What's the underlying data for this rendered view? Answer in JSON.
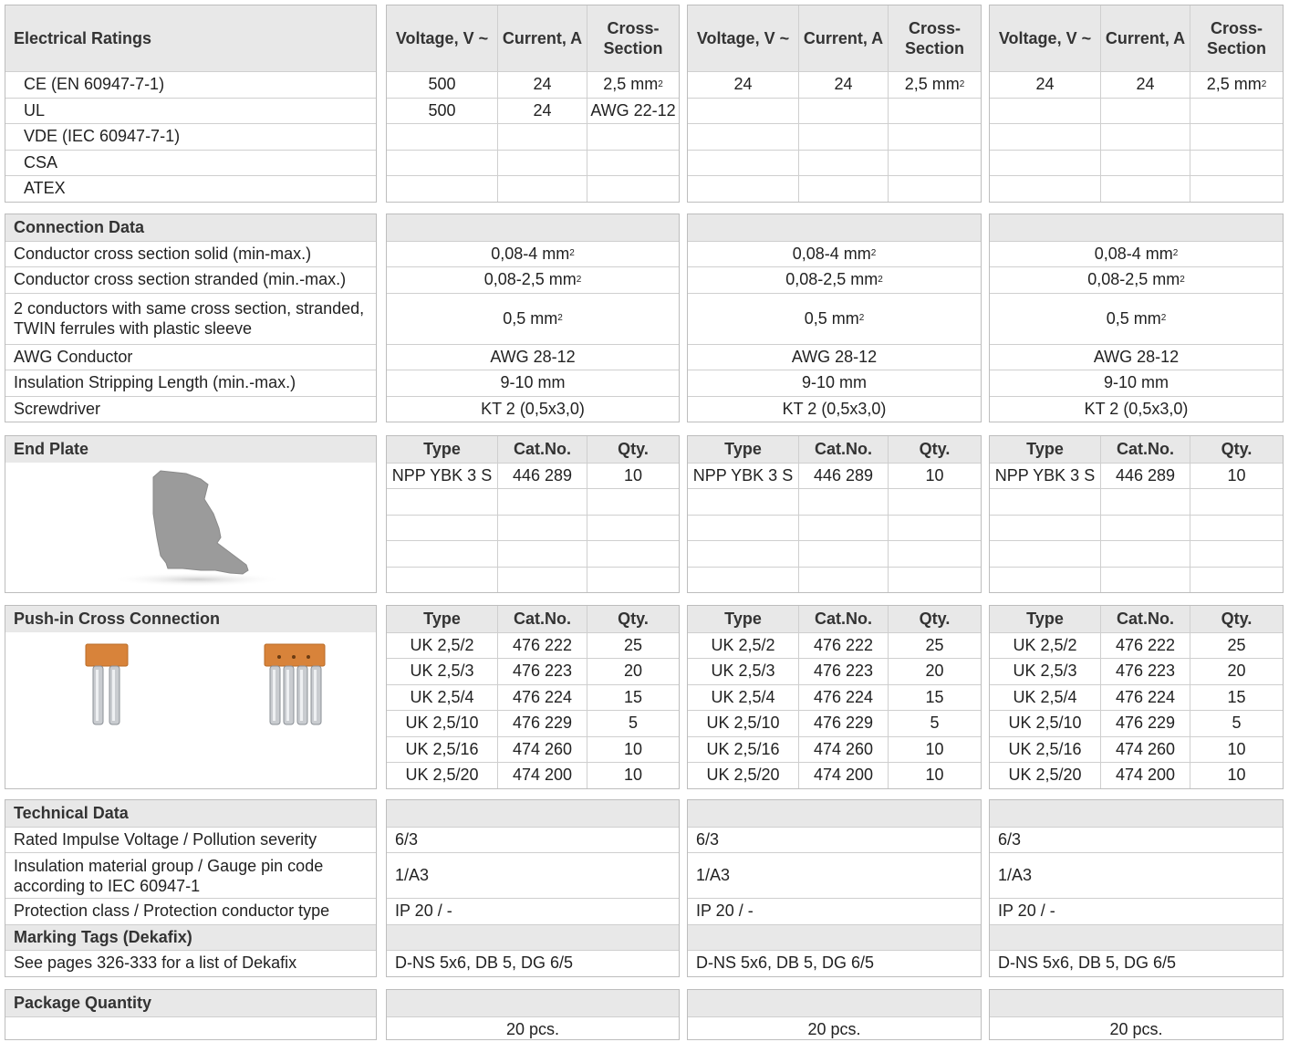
{
  "units": {
    "mm2": "mm",
    "sq": "2"
  },
  "electrical": {
    "title": "Electrical Ratings",
    "headers": [
      "Voltage, V ~",
      "Current, A",
      "Cross-Section"
    ],
    "rows": [
      "CE (EN 60947-7-1)",
      "UL",
      "VDE (IEC 60947-7-1)",
      "CSA",
      "ATEX"
    ],
    "columns": [
      {
        "ce": {
          "v": "500",
          "a": "24",
          "cs": "2,5 mm"
        },
        "ul": {
          "v": "500",
          "a": "24",
          "cs": "AWG 22-12"
        }
      },
      {
        "ce": {
          "v": "24",
          "a": "24",
          "cs": "2,5 mm"
        },
        "ul": {
          "v": "",
          "a": "",
          "cs": ""
        }
      },
      {
        "ce": {
          "v": "24",
          "a": "24",
          "cs": "2,5 mm"
        },
        "ul": {
          "v": "",
          "a": "",
          "cs": ""
        }
      }
    ]
  },
  "connection": {
    "title": "Connection Data",
    "rows": [
      "Conductor cross section solid (min-max.)",
      "Conductor cross section stranded (min.-max.)",
      "2 conductors with same cross section, stranded, TWIN ferrules with plastic sleeve",
      "AWG Conductor",
      "Insulation Stripping Length (min.-max.)",
      "Screwdriver"
    ],
    "values": [
      "0,08-4 mm",
      "0,08-2,5 mm",
      "0,5 mm",
      "AWG 28-12",
      "9-10 mm",
      "KT 2 (0,5x3,0)"
    ]
  },
  "endplate": {
    "title": "End Plate",
    "headers": [
      "Type",
      "Cat.No.",
      "Qty."
    ],
    "item": {
      "type": "NPP YBK 3 S",
      "cat": "446 289",
      "qty": "10"
    }
  },
  "cross": {
    "title": "Push-in Cross Connection",
    "headers": [
      "Type",
      "Cat.No.",
      "Qty."
    ],
    "items": [
      {
        "type": "UK 2,5/2",
        "cat": "476 222",
        "qty": "25"
      },
      {
        "type": "UK 2,5/3",
        "cat": "476 223",
        "qty": "20"
      },
      {
        "type": "UK 2,5/4",
        "cat": "476 224",
        "qty": "15"
      },
      {
        "type": "UK 2,5/10",
        "cat": "476 229",
        "qty": "5"
      },
      {
        "type": "UK 2,5/16",
        "cat": "474 260",
        "qty": "10"
      },
      {
        "type": "UK 2,5/20",
        "cat": "474 200",
        "qty": "10"
      }
    ]
  },
  "technical": {
    "title": "Technical Data",
    "rows": [
      "Rated Impulse Voltage / Pollution severity",
      "Insulation material group / Gauge pin code according to IEC 60947-1",
      "Protection class / Protection conductor type"
    ],
    "values": [
      "6/3",
      "1/A3",
      "IP 20 / -"
    ],
    "marking_title": "Marking Tags (Dekafix)",
    "marking_row": "See pages 326-333 for a list of Dekafix",
    "marking_value": "D-NS 5x6, DB 5, DG 6/5"
  },
  "package": {
    "title": "Package Quantity",
    "value": "20 pcs."
  },
  "colors": {
    "header_bg": "#e8e8e8",
    "border": "#bdbdbd",
    "bridge_orange": "#d8833a",
    "endplate_gray": "#9b9b9b"
  }
}
